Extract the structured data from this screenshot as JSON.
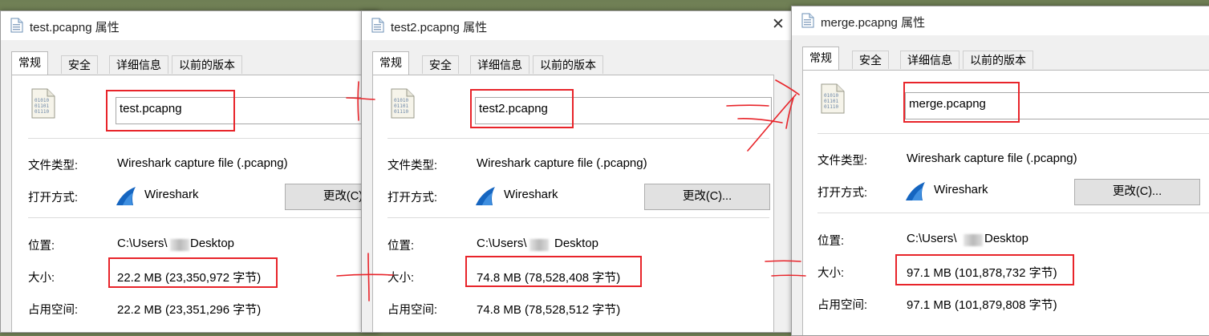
{
  "dialogs": [
    {
      "title": "test.pcapng 属性",
      "tabs": [
        "常规",
        "安全",
        "详细信息",
        "以前的版本"
      ],
      "filename": "test.pcapng",
      "type_label": "文件类型:",
      "type_value": "Wireshark capture file (.pcapng)",
      "open_label": "打开方式:",
      "open_app": "Wireshark",
      "change_button": "更改(C)...",
      "location_label": "位置:",
      "location_prefix": "C:\\Users\\",
      "location_suffix": "Desktop",
      "size_label": "大小:",
      "size_value": "22.2 MB (23,350,972 字节)",
      "disk_label": "占用空间:",
      "disk_value": "22.2 MB (23,351,296 字节)"
    },
    {
      "title": "test2.pcapng 属性",
      "tabs": [
        "常规",
        "安全",
        "详细信息",
        "以前的版本"
      ],
      "filename": "test2.pcapng",
      "type_label": "文件类型:",
      "type_value": "Wireshark capture file (.pcapng)",
      "open_label": "打开方式:",
      "open_app": "Wireshark",
      "change_button": "更改(C)...",
      "location_label": "位置:",
      "location_prefix": "C:\\Users\\",
      "location_suffix": "Desktop",
      "size_label": "大小:",
      "size_value": "74.8 MB (78,528,408 字节)",
      "disk_label": "占用空间:",
      "disk_value": "74.8 MB (78,528,512 字节)"
    },
    {
      "title": "merge.pcapng 属性",
      "tabs": [
        "常规",
        "安全",
        "详细信息",
        "以前的版本"
      ],
      "filename": "merge.pcapng",
      "type_label": "文件类型:",
      "type_value": "Wireshark capture file (.pcapng)",
      "open_label": "打开方式:",
      "open_app": "Wireshark",
      "change_button": "更改(C)...",
      "location_label": "位置:",
      "location_prefix": "C:\\Users\\",
      "location_suffix": "Desktop",
      "size_label": "大小:",
      "size_value": "97.1 MB (101,878,732 字节)",
      "disk_label": "占用空间:",
      "disk_value": "97.1 MB (101,879,808 字节)"
    }
  ],
  "close_glyph": "✕",
  "colors": {
    "annotation_red": "#e8242a",
    "wireshark_blue": "#1565c0",
    "button_face": "#e1e1e1"
  }
}
